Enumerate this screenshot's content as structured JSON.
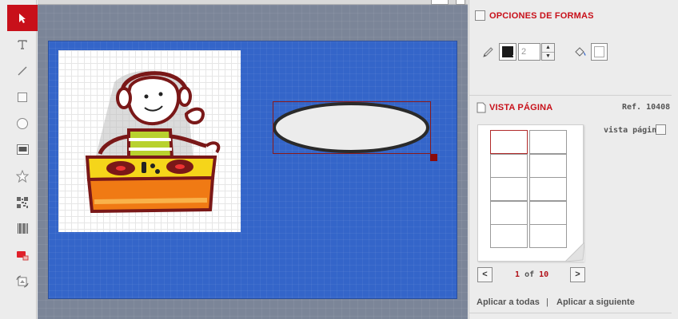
{
  "toolbar": {
    "tools": [
      {
        "name": "pointer",
        "icon": "arrow-pointer-icon",
        "active": true
      },
      {
        "name": "text",
        "icon": "text-t-icon"
      },
      {
        "name": "line",
        "icon": "line-icon"
      },
      {
        "name": "rectangle",
        "icon": "rectangle-icon"
      },
      {
        "name": "ellipse",
        "icon": "circle-icon"
      },
      {
        "name": "image",
        "icon": "image-icon"
      },
      {
        "name": "star",
        "icon": "star-icon"
      },
      {
        "name": "qr",
        "icon": "qr-code-icon"
      },
      {
        "name": "barcode",
        "icon": "barcode-icon"
      },
      {
        "name": "shapes-color",
        "icon": "colored-shape-icon"
      },
      {
        "name": "transform",
        "icon": "rotate-image-icon"
      }
    ],
    "active_color": "#c8101a"
  },
  "canvas": {
    "page_color": "#3465c9",
    "ellipse": {
      "fill": "#ececec",
      "stroke": "#2a2a2a"
    },
    "selection_color": "#8a1a1a"
  },
  "shape_options": {
    "title": "OPCIONES DE FORMAS",
    "stroke_width": "2",
    "stroke_color": "#1a1a1a"
  },
  "page_view": {
    "title": "VISTA PÁGINA",
    "ref": "Ref. 10408",
    "toggle_label": "vista página",
    "pager": {
      "current": "1",
      "of": "of",
      "total": "10"
    },
    "prev_label": "<",
    "next_label": ">",
    "apply_all": "Aplicar a todas",
    "separator": "|",
    "apply_next": "Aplicar a siguiente",
    "thumb_count": 10
  }
}
